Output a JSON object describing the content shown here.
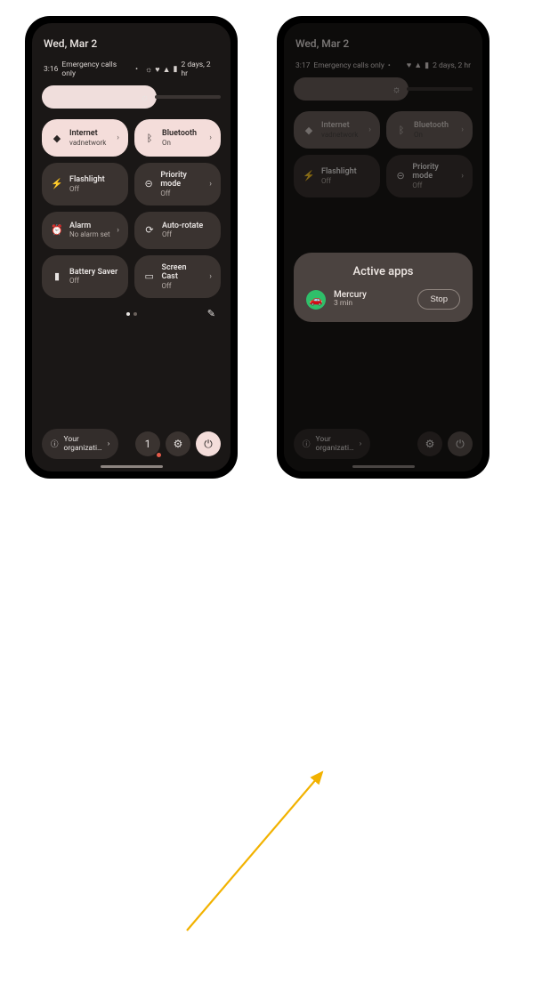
{
  "left": {
    "date": "Wed, Mar 2",
    "time": "3:16",
    "emergency": "Emergency calls only",
    "battery_text": "2 days, 2 hr",
    "tiles": [
      {
        "icon": "wifi",
        "label": "Internet",
        "sub": "vadnetwork",
        "active": true,
        "chevron": true
      },
      {
        "icon": "bt",
        "label": "Bluetooth",
        "sub": "On",
        "active": true,
        "chevron": true
      },
      {
        "icon": "flash",
        "label": "Flashlight",
        "sub": "Off",
        "active": false,
        "chevron": false
      },
      {
        "icon": "priority",
        "label": "Priority mode",
        "sub": "Off",
        "active": false,
        "chevron": true
      },
      {
        "icon": "alarm",
        "label": "Alarm",
        "sub": "No alarm set",
        "active": false,
        "chevron": true
      },
      {
        "icon": "rotate",
        "label": "Auto-rotate",
        "sub": "Off",
        "active": false,
        "chevron": false
      },
      {
        "icon": "battery",
        "label": "Battery Saver",
        "sub": "Off",
        "active": false,
        "chevron": false
      },
      {
        "icon": "cast",
        "label": "Screen Cast",
        "sub": "Off",
        "active": false,
        "chevron": true
      }
    ],
    "org_text": "Your organizati…",
    "badge_count": "1"
  },
  "right": {
    "date": "Wed, Mar 2",
    "time": "3:17",
    "emergency": "Emergency calls only",
    "battery_text": "2 days, 2 hr",
    "tiles_top": [
      {
        "icon": "wifi",
        "label": "Internet",
        "sub": "vadnetwork",
        "active": true,
        "chevron": true
      },
      {
        "icon": "bt",
        "label": "Bluetooth",
        "sub": "On",
        "active": true,
        "chevron": true
      },
      {
        "icon": "flash",
        "label": "Flashlight",
        "sub": "Off",
        "active": false,
        "chevron": false
      },
      {
        "icon": "priority",
        "label": "Priority mode",
        "sub": "Off",
        "active": false,
        "chevron": true
      }
    ],
    "active_apps": {
      "title": "Active apps",
      "app_name": "Mercury",
      "app_time": "3 min",
      "stop_label": "Stop"
    },
    "org_text": "Your organizati…"
  },
  "icons": {
    "wifi": "◆",
    "bt": "ᛒ",
    "flash": "⚡",
    "priority": "⊝",
    "alarm": "⏰",
    "rotate": "⟳",
    "battery": "▮",
    "cast": "▭",
    "brightness": "☼",
    "gear": "⚙",
    "power": "⏻",
    "info": "ⓘ",
    "edit": "✎",
    "chevron": "›",
    "car": "🚗",
    "heart": "♥",
    "signal": "▲",
    "batt": "▮",
    "dot": "•"
  }
}
